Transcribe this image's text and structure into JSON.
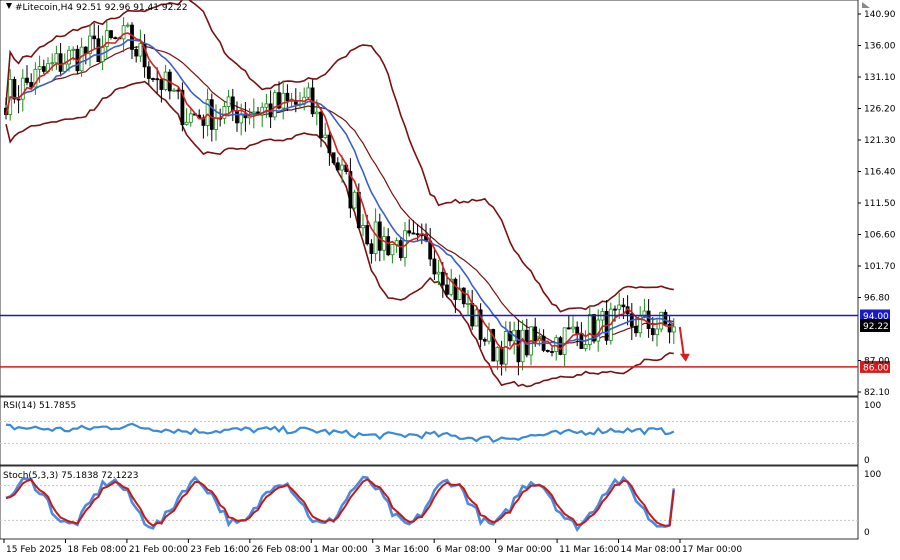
{
  "chart_data": [
    {
      "type": "candlestick",
      "title": "#Litecoin,H4  92.51 92.96 91.41 92.22",
      "ylim": [
        82.1,
        140.9
      ],
      "ytick_labels": [
        "140.90",
        "136.00",
        "131.10",
        "126.20",
        "121.30",
        "116.40",
        "111.50",
        "106.60",
        "101.70",
        "96.80",
        "87.00",
        "82.10"
      ],
      "xtick_labels": [
        "15 Feb 2025",
        "18 Feb 08:00",
        "21 Feb 00:00",
        "23 Feb 16:00",
        "26 Feb 08:00",
        "1 Mar 00:00",
        "3 Mar 16:00",
        "6 Mar 08:00",
        "9 Mar 00:00",
        "11 Mar 16:00",
        "14 Mar 08:00",
        "17 Mar 00:00"
      ],
      "x": [
        "15 Feb 2025",
        "18 Feb 08:00",
        "21 Feb 00:00",
        "23 Feb 16:00",
        "26 Feb 08:00",
        "1 Mar 00:00",
        "3 Mar 16:00",
        "6 Mar 08:00",
        "9 Mar 00:00",
        "11 Mar 16:00",
        "14 Mar 08:00",
        "17 Mar 00:00"
      ],
      "series": [
        {
          "values": [
            128,
            134,
            137,
            125,
            126,
            127,
            106,
            104,
            89,
            90,
            93,
            92.2
          ]
        }
      ],
      "levels": [
        {
          "value": 94.0,
          "label": "94.00",
          "color": "#1a1ac8"
        },
        {
          "value": 86.0,
          "label": "86.00",
          "color": "#d41c1c"
        }
      ],
      "current_price_label": "92.22",
      "current_price": 92.22,
      "forecast_arrow": "down",
      "overlays": [
        "Bollinger Bands (dark red)",
        "moving average (red)",
        "moving average (blue)"
      ],
      "colors": {
        "bull": "#1a8a1a",
        "bear": "#000000",
        "band": "#7a1010",
        "ma_fast": "#d42020",
        "ma_slow": "#3a5fc8"
      }
    },
    {
      "type": "line",
      "title": "RSI(14) 51.7855",
      "ylim": [
        0,
        100
      ],
      "ytick_labels": [
        "100",
        "0"
      ],
      "x": [
        "15 Feb 2025",
        "18 Feb 08:00",
        "21 Feb 00:00",
        "23 Feb 16:00",
        "26 Feb 08:00",
        "1 Mar 00:00",
        "3 Mar 16:00",
        "6 Mar 08:00",
        "9 Mar 00:00",
        "11 Mar 16:00",
        "14 Mar 08:00",
        "17 Mar 00:00"
      ],
      "series": [
        {
          "values": [
            60,
            55,
            62,
            52,
            55,
            54,
            44,
            46,
            38,
            47,
            55,
            51.8
          ]
        }
      ],
      "colors": {
        "line": "#3a8ad8"
      }
    },
    {
      "type": "line",
      "title": "Stoch(5,3,3) 75.1838 72.1223",
      "ylim": [
        0,
        100
      ],
      "ytick_labels": [
        "100",
        "0"
      ],
      "x": [
        "15 Feb 2025",
        "18 Feb 08:00",
        "21 Feb 00:00",
        "23 Feb 16:00",
        "26 Feb 08:00",
        "1 Mar 00:00",
        "3 Mar 16:00",
        "6 Mar 08:00",
        "9 Mar 00:00",
        "11 Mar 16:00",
        "14 Mar 08:00",
        "17 Mar 00:00"
      ],
      "series": [
        {
          "values": [
            80,
            20,
            85,
            15,
            85,
            80,
            15,
            80,
            10,
            85,
            85,
            75.2
          ]
        },
        {
          "values": [
            75,
            25,
            80,
            20,
            80,
            75,
            20,
            75,
            15,
            80,
            80,
            72.1
          ]
        }
      ],
      "colors": {
        "main": "#4a8ae0",
        "signal": "#c81818"
      }
    }
  ]
}
